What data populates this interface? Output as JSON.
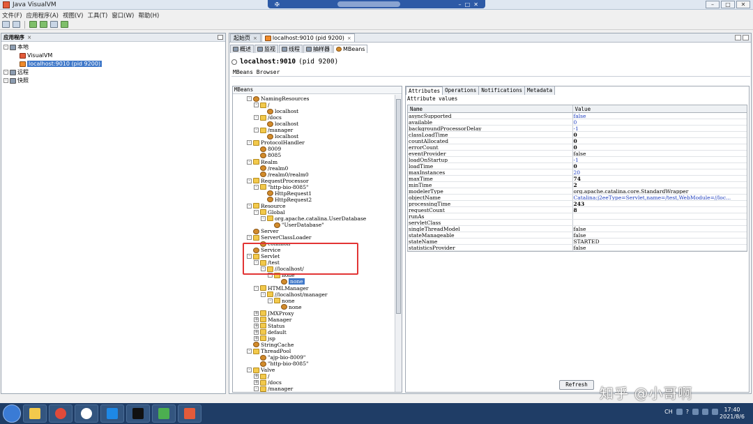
{
  "window": {
    "title": "Java VisualVM"
  },
  "remote_bar": {
    "pin": "✠",
    "min": "–",
    "restore": "□",
    "close": "✕"
  },
  "menu": [
    "文件(F)",
    "应用程序(A)",
    "视图(V)",
    "工具(T)",
    "窗口(W)",
    "帮助(H)"
  ],
  "window_controls": {
    "min": "–",
    "restore": "□",
    "close": "✕"
  },
  "apps_panel": {
    "title": "应用程序",
    "close": "×",
    "tree": [
      {
        "label": "本地",
        "indent": 0,
        "icon": "pc-icon"
      },
      {
        "label": "VisualVM",
        "indent": 1,
        "icon": "visualvm-icon"
      },
      {
        "label": "localhost:9010 (pid 9200)",
        "indent": 1,
        "icon": "java-process-icon",
        "selected": true
      },
      {
        "label": "远程",
        "indent": 0,
        "icon": "remote-icon"
      },
      {
        "label": "快照",
        "indent": 0,
        "icon": "snapshot-icon"
      }
    ]
  },
  "doc_tabs": [
    {
      "label": "起始页",
      "active": false
    },
    {
      "label": "localhost:9010 (pid 9200)",
      "active": true
    }
  ],
  "doc_tab_close": "×",
  "sub_tabs": [
    {
      "label": "概述",
      "active": false
    },
    {
      "label": "监视",
      "active": false
    },
    {
      "label": "线程",
      "active": false
    },
    {
      "label": "抽样器",
      "active": false
    },
    {
      "label": "MBeans",
      "active": true
    }
  ],
  "process": {
    "name": "localhost:9010",
    "pid": "(pid 9200)"
  },
  "mbeans_browser_label": "MBeans Browser",
  "mbeans_header": "MBeans",
  "mbeans_tree": [
    {
      "label": "NamingResources",
      "indent": 1,
      "pm": "-",
      "icon": "bean"
    },
    {
      "label": "/",
      "indent": 2,
      "pm": "-",
      "icon": "folder"
    },
    {
      "label": "localhost",
      "indent": 3,
      "pm": "",
      "icon": "bean"
    },
    {
      "label": "/docs",
      "indent": 2,
      "pm": "-",
      "icon": "folder"
    },
    {
      "label": "localhost",
      "indent": 3,
      "pm": "",
      "icon": "bean"
    },
    {
      "label": "/manager",
      "indent": 2,
      "pm": "-",
      "icon": "folder"
    },
    {
      "label": "localhost",
      "indent": 3,
      "pm": "",
      "icon": "bean"
    },
    {
      "label": "ProtocolHandler",
      "indent": 1,
      "pm": "-",
      "icon": "folder"
    },
    {
      "label": "8009",
      "indent": 2,
      "pm": "",
      "icon": "bean"
    },
    {
      "label": "8085",
      "indent": 2,
      "pm": "",
      "icon": "bean"
    },
    {
      "label": "Realm",
      "indent": 1,
      "pm": "-",
      "icon": "folder"
    },
    {
      "label": "/realm0",
      "indent": 2,
      "pm": "",
      "icon": "bean"
    },
    {
      "label": "/realm0/realm0",
      "indent": 2,
      "pm": "",
      "icon": "bean"
    },
    {
      "label": "RequestProcessor",
      "indent": 1,
      "pm": "-",
      "icon": "folder"
    },
    {
      "label": "\"http-bio-8085\"",
      "indent": 2,
      "pm": "-",
      "icon": "folder"
    },
    {
      "label": "HttpRequest1",
      "indent": 3,
      "pm": "",
      "icon": "bean"
    },
    {
      "label": "HttpRequest2",
      "indent": 3,
      "pm": "",
      "icon": "bean"
    },
    {
      "label": "Resource",
      "indent": 1,
      "pm": "-",
      "icon": "folder"
    },
    {
      "label": "Global",
      "indent": 2,
      "pm": "-",
      "icon": "folder"
    },
    {
      "label": "org.apache.catalina.UserDatabase",
      "indent": 3,
      "pm": "-",
      "icon": "folder"
    },
    {
      "label": "\"UserDatabase\"",
      "indent": 4,
      "pm": "",
      "icon": "bean"
    },
    {
      "label": "Server",
      "indent": 1,
      "pm": "",
      "icon": "bean"
    },
    {
      "label": "ServerClassLoader",
      "indent": 1,
      "pm": "-",
      "icon": "folder"
    },
    {
      "label": "common",
      "indent": 2,
      "pm": "",
      "icon": "bean"
    },
    {
      "label": "Service",
      "indent": 1,
      "pm": "",
      "icon": "bean"
    },
    {
      "label": "Servlet",
      "indent": 1,
      "pm": "-",
      "icon": "folder"
    },
    {
      "label": "/test",
      "indent": 2,
      "pm": "-",
      "icon": "folder"
    },
    {
      "label": "//localhost/",
      "indent": 3,
      "pm": "-",
      "icon": "folder"
    },
    {
      "label": "none",
      "indent": 4,
      "pm": "-",
      "icon": "folder"
    },
    {
      "label": "none",
      "indent": 5,
      "pm": "",
      "icon": "bean",
      "selected": true
    },
    {
      "label": "HTMLManager",
      "indent": 2,
      "pm": "-",
      "icon": "folder"
    },
    {
      "label": "//localhost/manager",
      "indent": 3,
      "pm": "-",
      "icon": "folder"
    },
    {
      "label": "none",
      "indent": 4,
      "pm": "-",
      "icon": "folder"
    },
    {
      "label": "none",
      "indent": 5,
      "pm": "",
      "icon": "bean"
    },
    {
      "label": "JMXProxy",
      "indent": 2,
      "pm": "+",
      "icon": "folder"
    },
    {
      "label": "Manager",
      "indent": 2,
      "pm": "+",
      "icon": "folder"
    },
    {
      "label": "Status",
      "indent": 2,
      "pm": "+",
      "icon": "folder"
    },
    {
      "label": "default",
      "indent": 2,
      "pm": "+",
      "icon": "folder"
    },
    {
      "label": "jsp",
      "indent": 2,
      "pm": "+",
      "icon": "folder"
    },
    {
      "label": "StringCache",
      "indent": 1,
      "pm": "",
      "icon": "bean"
    },
    {
      "label": "ThreadPool",
      "indent": 1,
      "pm": "-",
      "icon": "folder"
    },
    {
      "label": "\"ajp-bio-8009\"",
      "indent": 2,
      "pm": "",
      "icon": "bean"
    },
    {
      "label": "\"http-bio-8085\"",
      "indent": 2,
      "pm": "",
      "icon": "bean"
    },
    {
      "label": "Valve",
      "indent": 1,
      "pm": "-",
      "icon": "folder"
    },
    {
      "label": "/",
      "indent": 2,
      "pm": "+",
      "icon": "folder"
    },
    {
      "label": "/docs",
      "indent": 2,
      "pm": "+",
      "icon": "folder"
    },
    {
      "label": "/manager",
      "indent": 2,
      "pm": "-",
      "icon": "folder"
    },
    {
      "label": "localhost",
      "indent": 3,
      "pm": "",
      "icon": "bean"
    }
  ],
  "attr_tabs": [
    {
      "label": "Attributes",
      "active": true
    },
    {
      "label": "Operations",
      "active": false
    },
    {
      "label": "Notifications",
      "active": false
    },
    {
      "label": "Metadata",
      "active": false
    }
  ],
  "attr_values_label": "Attribute values",
  "attr_columns": {
    "name": "Name",
    "value": "Value"
  },
  "attributes": [
    {
      "name": "asyncSupported",
      "value": "false",
      "style": "link"
    },
    {
      "name": "available",
      "value": "0",
      "style": "link"
    },
    {
      "name": "backgroundProcessorDelay",
      "value": "-1",
      "style": "link"
    },
    {
      "name": "classLoadTime",
      "value": "0",
      "style": "bold"
    },
    {
      "name": "countAllocated",
      "value": "0",
      "style": "bold"
    },
    {
      "name": "errorCount",
      "value": "0",
      "style": "bold"
    },
    {
      "name": "eventProvider",
      "value": "false",
      "style": ""
    },
    {
      "name": "loadOnStartup",
      "value": "-1",
      "style": "link"
    },
    {
      "name": "loadTime",
      "value": "0",
      "style": "bold"
    },
    {
      "name": "maxInstances",
      "value": "20",
      "style": "link"
    },
    {
      "name": "maxTime",
      "value": "74",
      "style": "bold"
    },
    {
      "name": "minTime",
      "value": "2",
      "style": "bold"
    },
    {
      "name": "modelerType",
      "value": "org.apache.catalina.core.StandardWrapper",
      "style": ""
    },
    {
      "name": "objectName",
      "value": "Catalina:j2eeType=Servlet,name=/test,WebModule=//loc...",
      "style": "link"
    },
    {
      "name": "processingTime",
      "value": "243",
      "style": "bold"
    },
    {
      "name": "requestCount",
      "value": "8",
      "style": "bold"
    },
    {
      "name": "runAs",
      "value": "",
      "style": ""
    },
    {
      "name": "servletClass",
      "value": "",
      "style": ""
    },
    {
      "name": "singleThreadModel",
      "value": "false",
      "style": ""
    },
    {
      "name": "stateManageable",
      "value": "false",
      "style": ""
    },
    {
      "name": "stateName",
      "value": "STARTED",
      "style": ""
    },
    {
      "name": "statisticsProvider",
      "value": "false",
      "style": ""
    }
  ],
  "refresh_label": "Refresh",
  "watermark": "知乎 @小哥啊",
  "tray": {
    "lang": "CH",
    "help": "?"
  },
  "clock": {
    "time": "17:40",
    "date": "2021/8/6"
  },
  "colors": {
    "selection": "#3f78c9",
    "highlight_box": "#e23434",
    "link_value": "#1f3fbf"
  }
}
